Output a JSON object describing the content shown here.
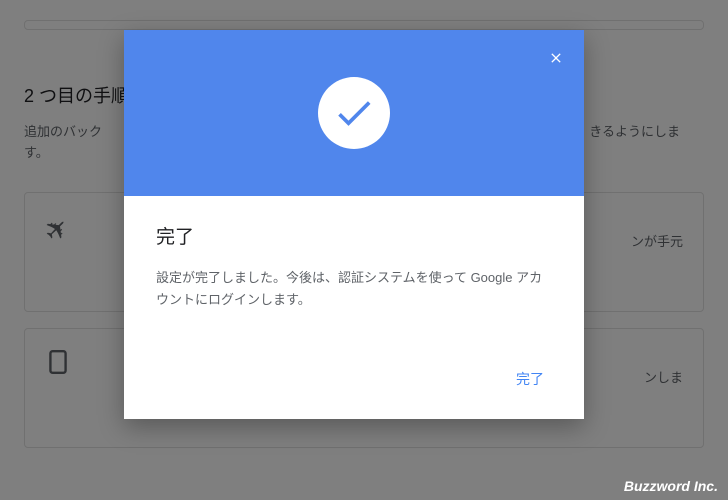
{
  "background": {
    "section_title": "2 つ目の手順",
    "section_desc_start": "追加のバック",
    "section_desc_end": "きるようにします。",
    "card1_text": "ンが手元",
    "card2_text": "ンしま"
  },
  "dialog": {
    "title": "完了",
    "description": "設定が完了しました。今後は、認証システムを使って Google アカウントにログインします。",
    "done_label": "完了"
  },
  "watermark": "Buzzword Inc."
}
